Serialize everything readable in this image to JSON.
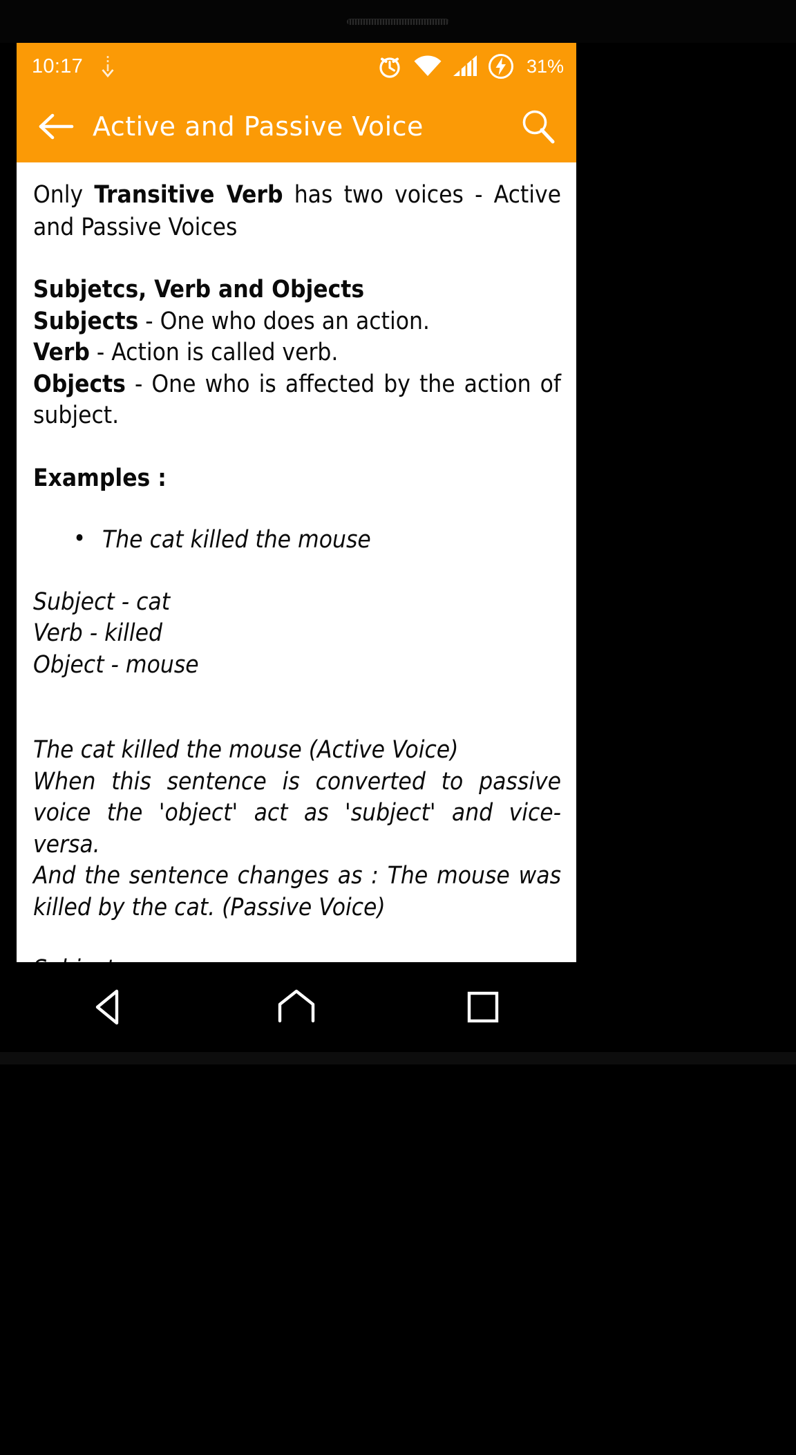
{
  "statusbar": {
    "time": "10:17",
    "download_icon": "download-arrow-icon",
    "alarm_icon": "alarm-clock-icon",
    "wifi_icon": "wifi-icon",
    "signal_icon": "cellular-signal-icon",
    "battery_icon": "battery-charging-icon",
    "battery_percent": "31%"
  },
  "appbar": {
    "back_icon": "arrow-left-icon",
    "title": "Active and Passive Voice",
    "search_icon": "search-icon",
    "background_color": "#FB9A06",
    "text_color": "#FFFFFF"
  },
  "lesson": {
    "intro": {
      "pre": "Only ",
      "bold": "Transitive Verb",
      "post": " has two voices - Active and Passive Voices"
    },
    "section_heading": "Subjetcs, Verb and Objects",
    "definitions": [
      {
        "term": "Subjects",
        "text": " - One who does an action."
      },
      {
        "term": "Verb",
        "text": " - Action is called verb."
      },
      {
        "term": "Objects",
        "text": " - One who is affected by the action of subject."
      }
    ],
    "examples_heading": "Examples :",
    "example_bullets": [
      "The cat killed the mouse"
    ],
    "breakdown": [
      "Subject - cat",
      "Verb - killed",
      "Object - mouse"
    ],
    "explanation": [
      "The cat killed the mouse (Active Voice)",
      "When this sentence is converted to passive voice the 'object' act as 'subject' and vice-versa.",
      "And the sentence changes as : The mouse was killed by the cat. (Passive Voice)"
    ],
    "breakdown2": [
      "Subject - mouse"
    ]
  },
  "navbar": {
    "back_icon": "nav-back-triangle-icon",
    "home_icon": "nav-home-icon",
    "recents_icon": "nav-recents-square-icon"
  }
}
